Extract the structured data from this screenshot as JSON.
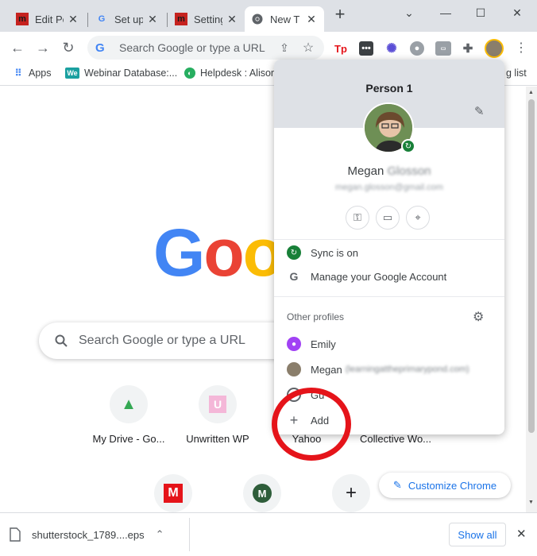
{
  "tabs": [
    {
      "title": "Edit Po",
      "favicon": "m"
    },
    {
      "title": "Set up",
      "favicon": "G"
    },
    {
      "title": "Setting",
      "favicon": "m"
    },
    {
      "title": "New T",
      "favicon": "chrome",
      "active": true
    }
  ],
  "new_tab_symbol": "+",
  "window_controls": {
    "minimize": "—",
    "maximize": "☐",
    "close": "✕",
    "menu": "⌄"
  },
  "toolbar": {
    "omnibox_placeholder": "Search Google or type a URL",
    "ext_tp": "Tp"
  },
  "bookmarks": [
    {
      "label": "Apps",
      "icon": "apps-icon"
    },
    {
      "label": "Webinar Database:...",
      "icon": "We"
    },
    {
      "label": "Helpdesk : Alison",
      "icon": "helpdesk-icon"
    },
    {
      "label": "g list",
      "icon": ""
    }
  ],
  "page": {
    "logo_letters": [
      "G",
      "o",
      "o"
    ],
    "search_placeholder": "Search Google or type a URL",
    "shortcuts": [
      {
        "label": "My Drive - Go...",
        "glyph": "▲"
      },
      {
        "label": "Unwritten WP",
        "glyph": "U"
      },
      {
        "label": "Yahoo",
        "glyph": ""
      },
      {
        "label": "Collective Wo...",
        "glyph": ""
      }
    ],
    "shortcuts_row2": [
      {
        "glyph": "M"
      },
      {
        "glyph": "M"
      },
      {
        "glyph": "+"
      }
    ],
    "customize_label": "Customize Chrome"
  },
  "downloads": {
    "file_name": "shutterstock_1789....eps",
    "show_all": "Show all"
  },
  "profile_popup": {
    "title": "Person 1",
    "name_first": "Megan",
    "name_last": "Glosson",
    "email": "megan.glosson@gmail.com",
    "sync_label": "Sync is on",
    "manage_label": "Manage your Google Account",
    "other_profiles_label": "Other profiles",
    "other_profiles": [
      {
        "name": "Emily",
        "detail": ""
      },
      {
        "name": "Megan",
        "detail": "(learningattheprimarypond.com)"
      },
      {
        "name": "Gu",
        "detail": ""
      }
    ],
    "add_label": "Add"
  },
  "colors": {
    "google_blue": "#4285f4",
    "google_red": "#ea4335",
    "google_yellow": "#fbbc05",
    "accent_blue": "#1a73e8",
    "annotation_red": "#e5141a"
  }
}
